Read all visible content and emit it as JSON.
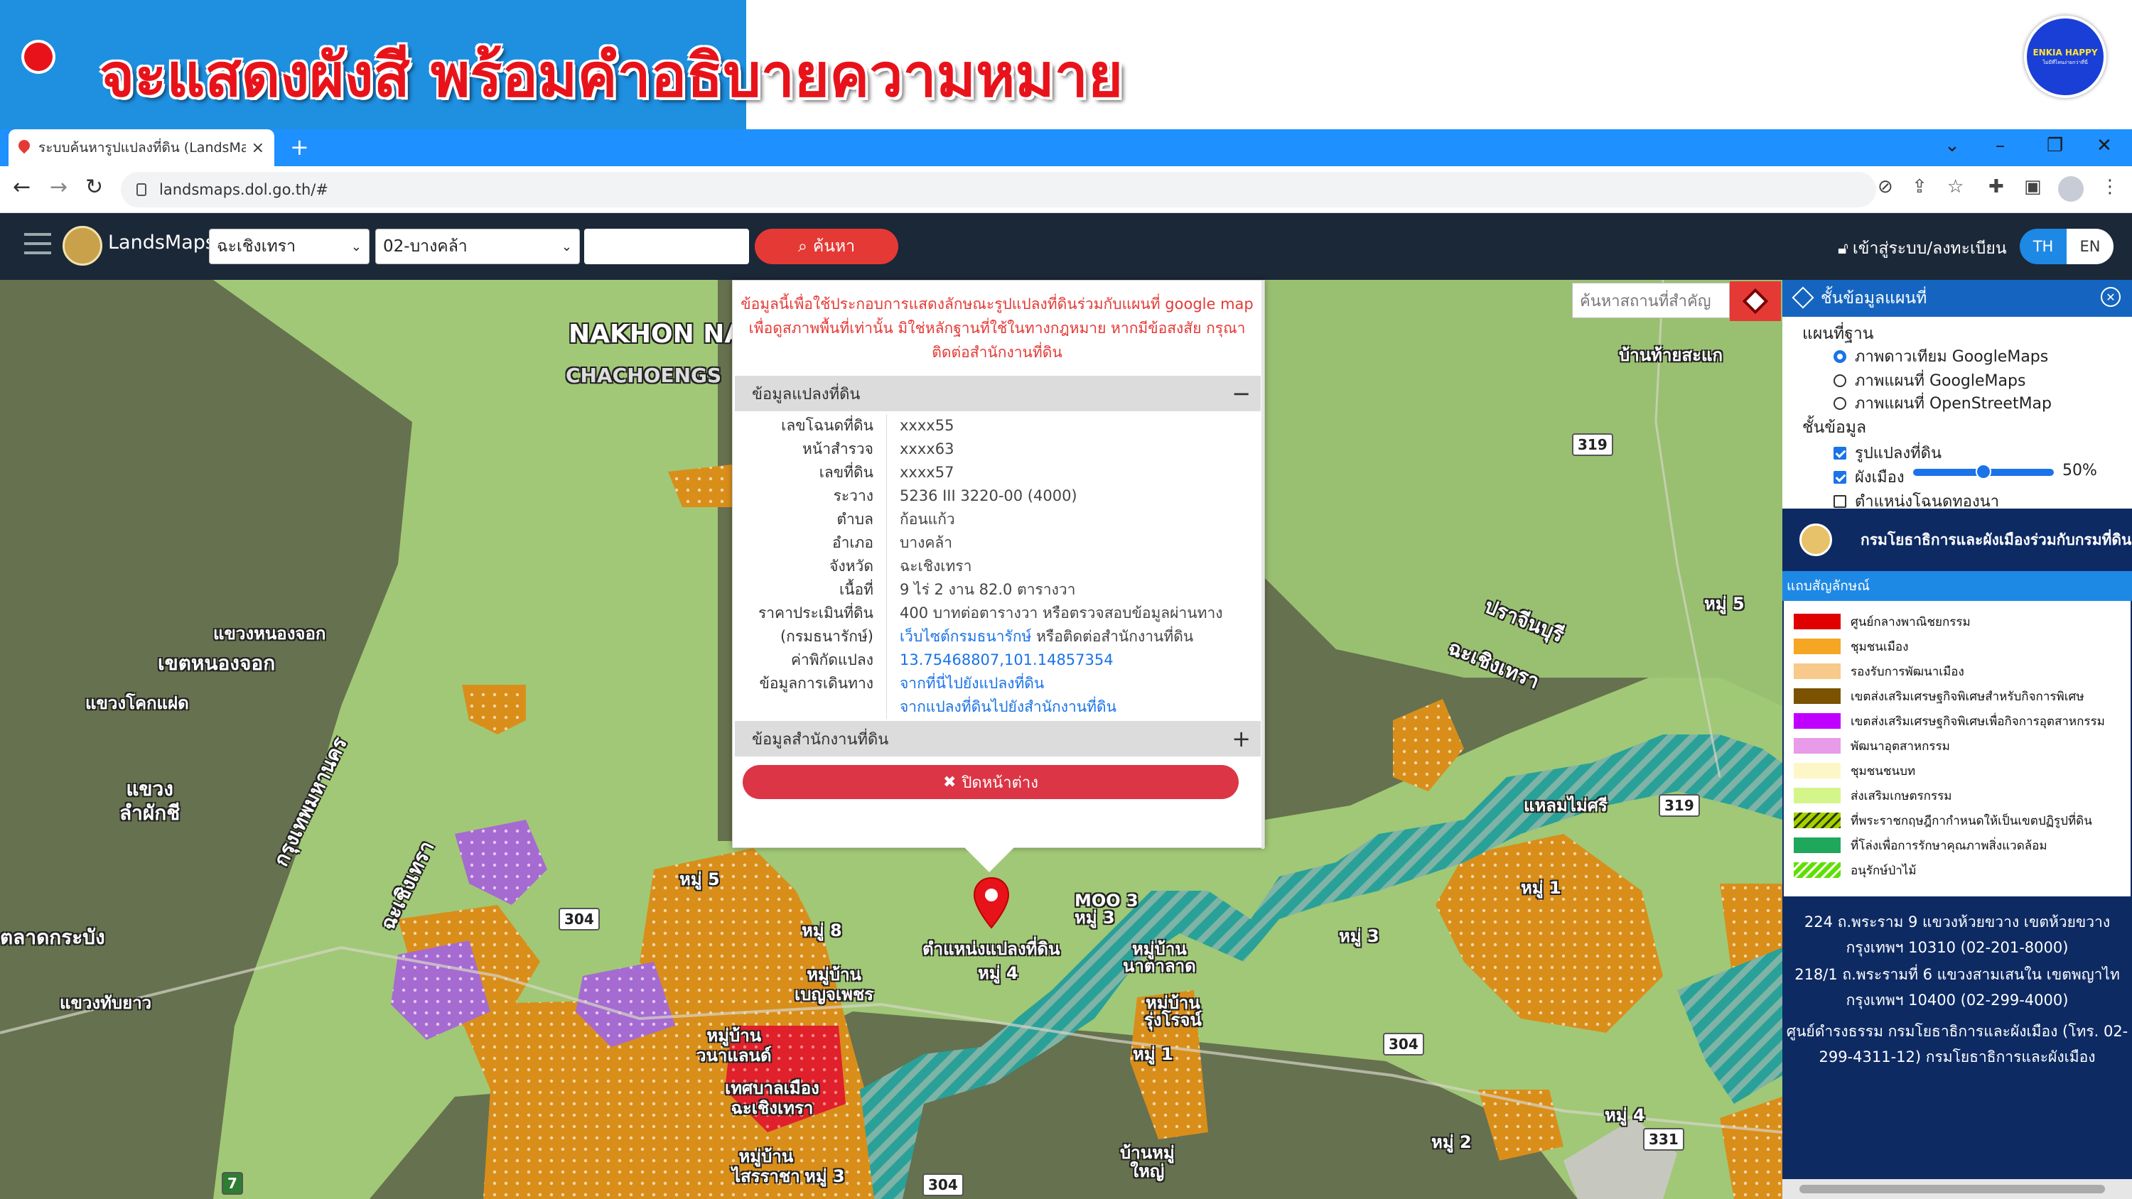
{
  "banner": {
    "title": "จะแสดงผังสี พร้อมคำอธิบายความหมาย",
    "logo_top": "ENKIA HAPPY",
    "logo_bottom": "ไม่มีที่ไหนง่ายกว่าที่นี่"
  },
  "browser": {
    "tab_title": "ระบบค้นหารูปแปลงที่ดิน (LandsMaps",
    "tab_close": "×",
    "new_tab": "+",
    "url": "landsmaps.dol.go.th/#",
    "window_controls": [
      "⌄",
      "–",
      "❐",
      "✕"
    ]
  },
  "app": {
    "brand": "LandsMaps",
    "province": "ฉะเชิงเทรา",
    "district": "02-บางคล้า",
    "search_value": "",
    "search_button": "ค้นหา",
    "login": "เข้าสู่ระบบ/ลงทะเบียน",
    "lang_th": "TH",
    "lang_en": "EN",
    "accent": "#e53935"
  },
  "map": {
    "search_placeholder": "ค้นหาสถานที่สำคัญ",
    "labels": {
      "nakhon": "NAKHON NAY",
      "chachoeng": "CHACHOENGS",
      "nongchok_small": "แขวงหนองจอก",
      "nongchok_district": "เขตหนองจอก",
      "khok_faet": "แขวงโคกแฝด",
      "lam_phak_chi": "แขวง\nลำผักชี",
      "bkk": "กรุงเทพมหานคร",
      "chacho_vertical": "ฉะเชิงเทรา",
      "lat_krabang": "ตลาดกระบัง",
      "thap_yao": "แขวงทับยาว",
      "prachin": "ปราจีนบุรี",
      "chacho_right": "ฉะเชิงเทรา",
      "ban_thai": "บ้านท้ายสะแก",
      "moo5_right": "หมู่ 5",
      "laem_mai": "แหลมไม่ศรี",
      "moo5": "หมู่ 5",
      "moo8": "หมู่ 8",
      "ban_benjaphet": "หมู่บ้าน\nเบญจเพชร",
      "ban_wanaland": "หมู่บ้าน\nวนาแลนด์",
      "tessaban": "เทศบาลเมือง\nฉะเชิงเทรา",
      "ban_sirichai": "หมู่บ้าน\nไสรราชา",
      "moo3_bottom": "หมู่ 3",
      "moo4": "หมู่ 4",
      "moo3_mid": "MOO 3\nหมู่ 3",
      "ban_natalat": "หมู่บ้าน\nนาตาลาด",
      "ban_rungroj": "หมู่บ้าน\nรุ่งโรจน์",
      "moo1": "หมู่ 1",
      "moo3_right": "หมู่ 3",
      "moo1_right": "หมู่ 1",
      "moo2": "หมู่ 2",
      "moo4_right": "หมู่ 4",
      "ban_mai": "บ้านหมู่\nใหญ่",
      "pin_label": "ตำแหน่งแปลงที่ดิน",
      "road_319": "319",
      "road_319b": "319",
      "road_304a": "304",
      "road_304b": "304",
      "road_304c": "304",
      "road_331": "331",
      "road_7": "7"
    }
  },
  "popup": {
    "disclaimer": "ข้อมูลนี้เพื่อใช้ประกอบการแสดงลักษณะรูปแปลงที่ดินร่วมกับแผนที่ google map เพื่อดูสภาพพื้นที่เท่านั้น มิใช่หลักฐานที่ใช้ในทางกฎหมาย หากมีข้อสงสัย กรุณาติดต่อสำนักงานที่ดิน",
    "section_land": "ข้อมูลแปลงที่ดิน",
    "section_land_toggle": "−",
    "rows": [
      {
        "k": "เลขโฉนดที่ดิน",
        "v": "xxxx55"
      },
      {
        "k": "หน้าสำรวจ",
        "v": "xxxx63"
      },
      {
        "k": "เลขที่ดิน",
        "v": "xxxx57"
      },
      {
        "k": "ระวาง",
        "v": "5236 III 3220-00 (4000)"
      },
      {
        "k": "ตำบล",
        "v": "ก้อนแก้ว"
      },
      {
        "k": "อำเภอ",
        "v": "บางคล้า"
      },
      {
        "k": "จังหวัด",
        "v": "ฉะเชิงเทรา"
      },
      {
        "k": "เนื้อที่",
        "v": "9 ไร่ 2 งาน 82.0 ตารางวา"
      },
      {
        "k": "ราคาประเมินที่ดิน",
        "v": "400 บาทต่อตารางวา หรือตรวจสอบข้อมูลผ่านทาง"
      },
      {
        "k": "(กรมธนารักษ์)",
        "v_link": "เว็บไซต์กรมธนารักษ์",
        "v_rest": " หรือติดต่อสำนักงานที่ดิน"
      },
      {
        "k": "ค่าพิกัดแปลง",
        "v": "13.75468807,101.14857354"
      },
      {
        "k": "ข้อมูลการเดินทาง",
        "v": "จากที่นี่ไปยังแปลงที่ดิน"
      },
      {
        "k": "",
        "v": "จากแปลงที่ดินไปยังสำนักงานที่ดิน"
      }
    ],
    "section_office": "ข้อมูลสำนักงานที่ดิน",
    "section_office_toggle": "+",
    "close_button": "ปิดหน้าต่าง"
  },
  "panel": {
    "title": "ชั้นข้อมูลแผนที่",
    "base_map": "แผนที่ฐาน",
    "base_options": [
      "ภาพดาวเทียม GoogleMaps",
      "ภาพแผนที่ GoogleMaps",
      "ภาพแผนที่ OpenStreetMap"
    ],
    "layers": "ชั้นข้อมูล",
    "layer_parcels": "รูปแปลงที่ดิน",
    "layer_zoning": "ผังเมือง",
    "opacity": "50%",
    "opacity_value": 0.5,
    "layer_office": "ตำแหน่งโฉนดทองนา",
    "dept": "กรมโยธาธิการและผังเมืองร่วมกับกรมที่ดิน",
    "legend_title": "แถบสัญลักษณ์",
    "legend": [
      {
        "label": "ศูนย์กลางพาณิชยกรรม",
        "color": "#e00000",
        "pattern": "solid"
      },
      {
        "label": "ชุมชนเมือง",
        "color": "#f5a623",
        "pattern": "solid"
      },
      {
        "label": "รองรับการพัฒนาเมือง",
        "color": "#f7c98a",
        "pattern": "solid"
      },
      {
        "label": "เขตส่งเสริมเศรษฐกิจพิเศษสำหรับกิจการพิเศษ",
        "color": "#7a5200",
        "pattern": "solid"
      },
      {
        "label": "เขตส่งเสริมเศรษฐกิจพิเศษเพื่อกิจการอุตสาหกรรม",
        "color": "#c000ff",
        "pattern": "solid"
      },
      {
        "label": "พัฒนาอุตสาหกรรม",
        "color": "#e79be8",
        "pattern": "solid"
      },
      {
        "label": "ชุมชนชนบท",
        "color": "#fdf7c8",
        "pattern": "solid"
      },
      {
        "label": "ส่งเสริมเกษตรกรรม",
        "color": "#d4f58a",
        "pattern": "solid"
      },
      {
        "label": "ที่พระราชกฤษฎีกากำหนดให้เป็นเขตปฏิรูปที่ดิน",
        "color": "#a6d100",
        "pattern": "hatch-dark"
      },
      {
        "label": "ที่โล่งเพื่อการรักษาคุณภาพสิ่งแวดล้อม",
        "color": "#1fa85c",
        "pattern": "solid"
      },
      {
        "label": "อนุรักษ์ป่าไม้",
        "color": "#5ee000",
        "pattern": "hatch"
      }
    ],
    "address1": "224 ถ.พระราม 9 แขวงห้วยขวาง เขตห้วยขวาง กรุงเทพฯ 10310 (02-201-8000)",
    "address2": "218/1 ถ.พระรามที่ 6 แขวงสามเสนใน เขตพญาไท กรุงเทพฯ 10400 (02-299-4000)",
    "address3": "ศูนย์ดำรงธรรม กรมโยธาธิการและผังเมือง (โทร. 02-299-4311-12) กรมโยธาธิการและผังเมือง"
  }
}
